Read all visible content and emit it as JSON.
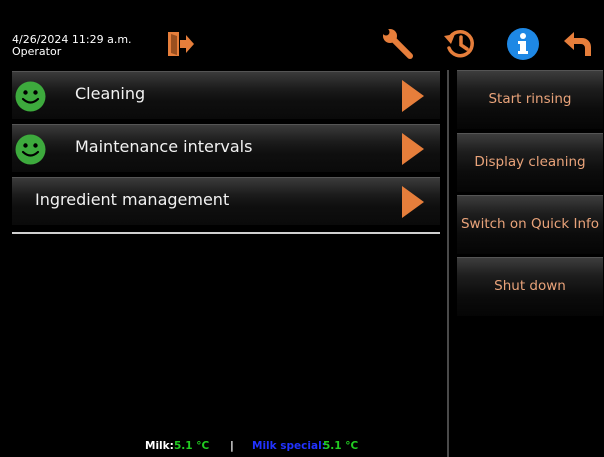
{
  "header": {
    "datetime": "4/26/2024 11:29 a.m.",
    "user_role": "Operator",
    "icons": [
      "logout-icon",
      "wrench-icon",
      "history-icon",
      "info-icon",
      "back-icon"
    ]
  },
  "menu": {
    "items": [
      {
        "label": "Cleaning",
        "status_icon": "smiley-ok-icon"
      },
      {
        "label": "Maintenance intervals",
        "status_icon": "smiley-ok-icon"
      },
      {
        "label": "Ingredient management"
      }
    ]
  },
  "side_buttons": [
    {
      "label": "Start rinsing"
    },
    {
      "label": "Display cleaning"
    },
    {
      "label": "Switch on Quick Info"
    },
    {
      "label": "Shut down"
    }
  ],
  "footer": {
    "milk_label": "Milk:",
    "milk_temp": "5.1 °C",
    "separator": "|",
    "milk_special_label": "Milk special:",
    "milk_special_temp": "5.1 °C"
  },
  "colors": {
    "accent": "#E67E3B",
    "side_text": "#E9A37A",
    "info_blue": "#1E88E5",
    "smiley_green": "#3DAA3D",
    "temp_green": "#22CC22",
    "milk_special_blue": "#2233FF"
  }
}
